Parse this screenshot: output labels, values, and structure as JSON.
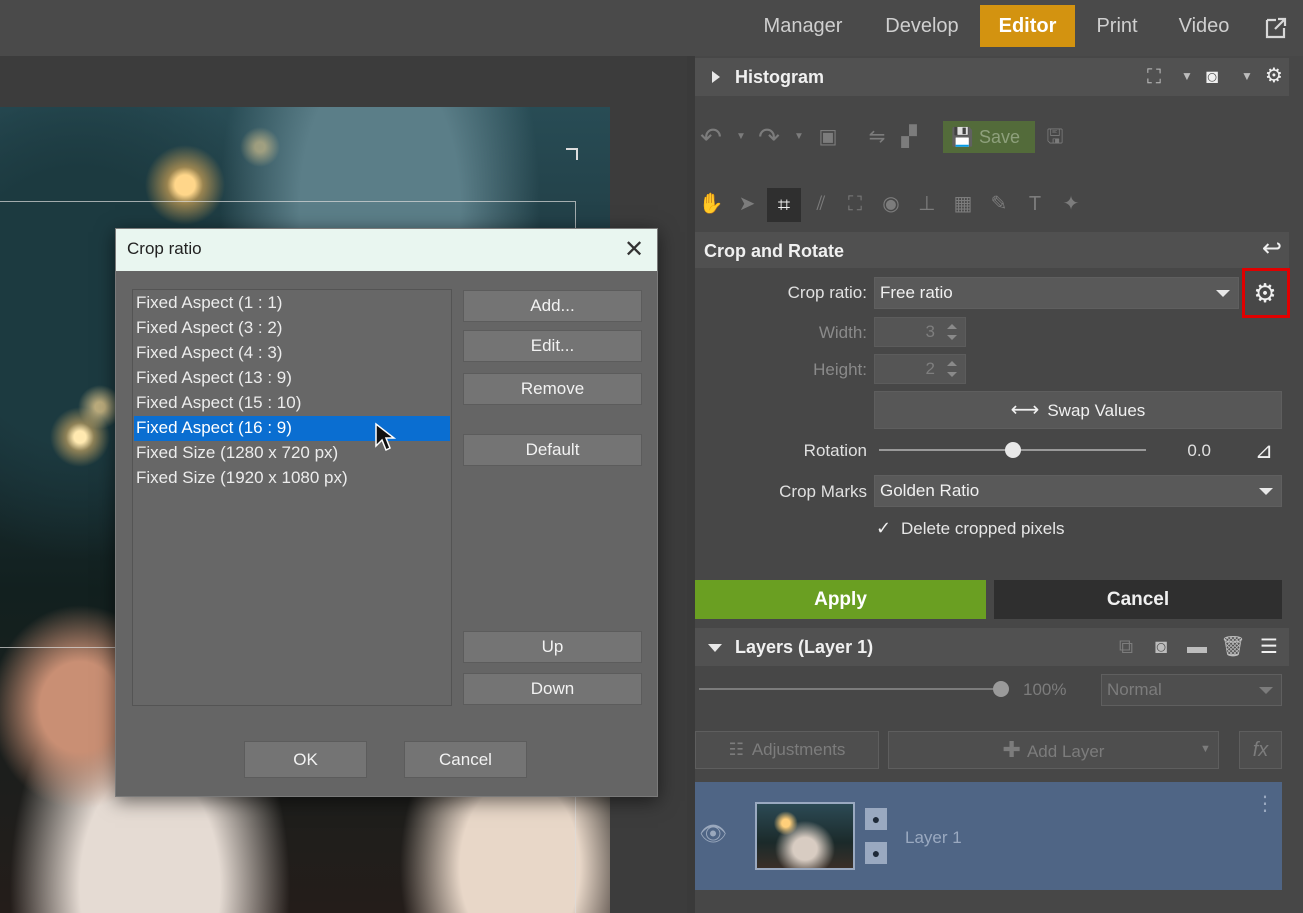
{
  "top_nav": {
    "tabs": [
      "Manager",
      "Develop",
      "Editor",
      "Print",
      "Video"
    ],
    "active_tab": "Editor",
    "popout_icon": "external-window-icon"
  },
  "histogram": {
    "title": "Histogram"
  },
  "toolbar": {
    "save_label": "Save"
  },
  "crop_rotate": {
    "title": "Crop and Rotate",
    "crop_ratio_label": "Crop ratio:",
    "crop_ratio_value": "Free ratio",
    "width_label": "Width:",
    "width_value": "3",
    "height_label": "Height:",
    "height_value": "2",
    "swap_label": "Swap Values",
    "rotation_label": "Rotation",
    "rotation_value": "0.0",
    "rotation_slider_level": 0.5,
    "crop_marks_label": "Crop Marks",
    "crop_marks_value": "Golden Ratio",
    "delete_pixels_label": "Delete cropped pixels",
    "delete_pixels_checked": true,
    "apply_label": "Apply",
    "cancel_label": "Cancel"
  },
  "layers": {
    "title": "Layers (Layer 1)",
    "opacity": "100%",
    "opacity_level": 1.0,
    "blend_mode": "Normal",
    "adjustments_label": "Adjustments",
    "add_layer_label": "Add Layer",
    "fx_label": "fx",
    "items": [
      {
        "name": "Layer 1"
      }
    ]
  },
  "dialog": {
    "title": "Crop ratio",
    "items": [
      "Fixed Aspect (1 : 1)",
      "Fixed Aspect (3 : 2)",
      "Fixed Aspect (4 : 3)",
      "Fixed Aspect (13 : 9)",
      "Fixed Aspect (15 : 10)",
      "Fixed Aspect (16 : 9)",
      "Fixed Size (1280 x 720 px)",
      "Fixed Size (1920 x 1080 px)"
    ],
    "selected_item": "Fixed Aspect (16 : 9)",
    "buttons": {
      "add": "Add...",
      "edit": "Edit...",
      "remove": "Remove",
      "default": "Default",
      "up": "Up",
      "down": "Down",
      "ok": "OK",
      "cancel": "Cancel"
    }
  },
  "colors": {
    "active_tab": "#d39310",
    "apply": "#6a9f22",
    "selection": "#0a6ed1",
    "highlight_box": "#e00000",
    "layer_row": "#4f6585"
  }
}
